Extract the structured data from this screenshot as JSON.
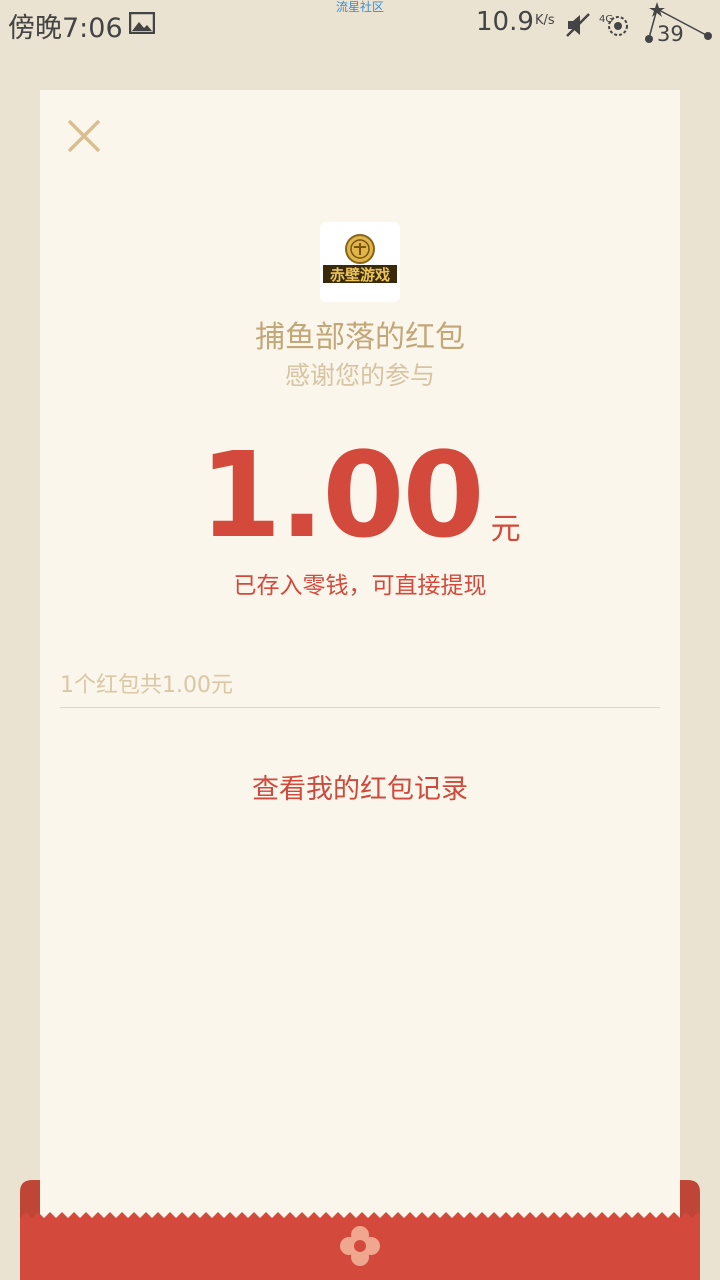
{
  "status_bar": {
    "time": "傍晚7:06",
    "watermark": "流星社区",
    "net_speed": "10.9",
    "net_unit": "K/s",
    "battery": "39"
  },
  "logo": {
    "text": "赤壁游戏"
  },
  "packet": {
    "sender": "捕鱼部落的红包",
    "thanks": "感谢您的参与",
    "amount": "1.00",
    "unit": "元",
    "saved_note": "已存入零钱，可直接提现",
    "summary": "1个红包共1.00元",
    "records_link": "查看我的红包记录"
  },
  "colors": {
    "background": "#ebe3d2",
    "card": "#fbf6eb",
    "accent_red": "#d3493b",
    "gold": "#c2a878"
  }
}
